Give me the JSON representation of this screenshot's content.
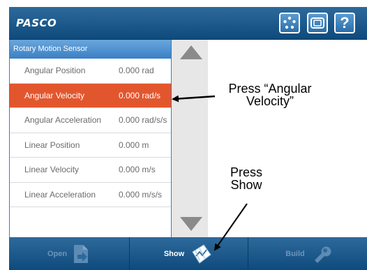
{
  "header": {
    "logo": "PASCO",
    "buttons": [
      {
        "icon": "sensor-dots-icon"
      },
      {
        "icon": "device-icon"
      },
      {
        "label": "?"
      }
    ]
  },
  "sensor_list": {
    "title": "Rotary Motion Sensor",
    "rows": [
      {
        "label": "Angular Position",
        "value": "0.000 rad"
      },
      {
        "label": "Angular Velocity",
        "value": "0.000 rad/s",
        "selected": true
      },
      {
        "label": "Angular Acceleration",
        "value": "0.000 rad/s/s"
      },
      {
        "label": "Linear Position",
        "value": "0.000 m"
      },
      {
        "label": "Linear Velocity",
        "value": "0.000 m/s"
      },
      {
        "label": "Linear Acceleration",
        "value": "0.000 m/s/s"
      }
    ]
  },
  "toolbar": {
    "open_label": "Open",
    "show_label": "Show",
    "build_label": "Build"
  },
  "annotations": {
    "press_velocity_line1": "Press “Angular",
    "press_velocity_line2": "Velocity”",
    "press_show_line1": "Press",
    "press_show_line2": "Show"
  },
  "colors": {
    "header_bg": "#1f5a8c",
    "selected_row": "#e2562e",
    "list_title_bg": "#4a8fd0"
  }
}
